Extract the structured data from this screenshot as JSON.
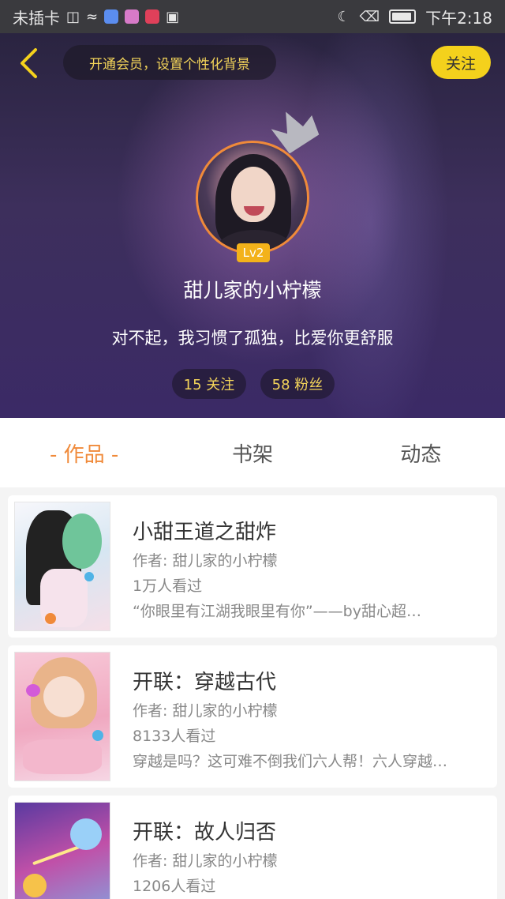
{
  "status_bar": {
    "carrier": "未插卡",
    "time": "下午2:18"
  },
  "header": {
    "vip_prompt": "开通会员，设置个性化背景",
    "follow_label": "关注",
    "level": "Lv2",
    "nickname": "甜儿家的小柠檬",
    "signature": "对不起，我习惯了孤独，比爱你更舒服",
    "following": "15 关注",
    "followers": "58 粉丝"
  },
  "tabs": [
    {
      "label": "- 作品 -",
      "active": true
    },
    {
      "label": "书架",
      "active": false
    },
    {
      "label": "动态",
      "active": false
    }
  ],
  "works": [
    {
      "title": "小甜王道之甜炸",
      "author": "作者: 甜儿家的小柠檬",
      "views": "1万人看过",
      "desc": "“你眼里有江湖我眼里有你”——by甜心超…"
    },
    {
      "title": "开联：穿越古代",
      "author": "作者: 甜儿家的小柠檬",
      "views": "8133人看过",
      "desc": "穿越是吗？这可难不倒我们六人帮！六人穿越…"
    },
    {
      "title": "开联：故人归否",
      "author": "作者: 甜儿家的小柠檬",
      "views": "1206人看过",
      "desc": ""
    }
  ],
  "colors": {
    "accent": "#f08a3a",
    "follow_button": "#f4d11c",
    "gold_text": "#f4d55a"
  }
}
